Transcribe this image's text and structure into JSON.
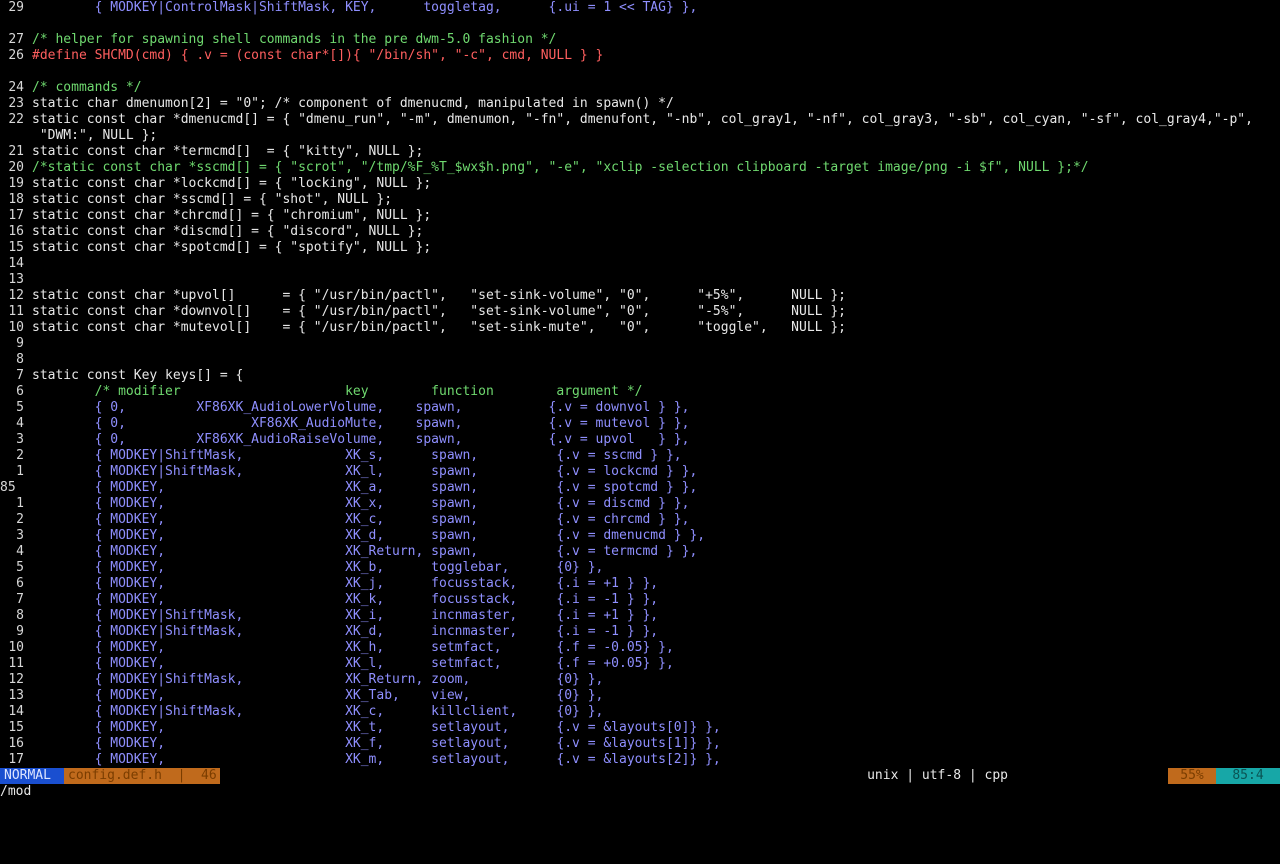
{
  "editor": {
    "lines": [
      {
        "n": "29",
        "t": "        { MODKEY|ControlMask|ShiftMask, KEY,      toggletag,      {.ui = 1 << TAG} },",
        "cls": "v"
      },
      {
        "n": "",
        "t": ""
      },
      {
        "n": "27",
        "t": "/* helper for spawning shell commands in the pre dwm-5.0 fashion */",
        "cls": "c"
      },
      {
        "n": "26",
        "t": "#define SHCMD(cmd) { .v = (const char*[]){ \"/bin/sh\", \"-c\", cmd, NULL } }",
        "cls": "r"
      },
      {
        "n": "",
        "t": ""
      },
      {
        "n": "24",
        "t": "/* commands */",
        "cls": "c"
      },
      {
        "n": "23",
        "t": "static char dmenumon[2] = \"0\"; /* component of dmenucmd, manipulated in spawn() */",
        "cls": "k"
      },
      {
        "n": "22",
        "t": "static const char *dmenucmd[] = { \"dmenu_run\", \"-m\", dmenumon, \"-fn\", dmenufont, \"-nb\", col_gray1, \"-nf\", col_gray3, \"-sb\", col_cyan, \"-sf\", col_gray4,\"-p\",",
        "cls": "k"
      },
      {
        "n": "",
        "t": " \"DWM:\", NULL };",
        "cls": "k"
      },
      {
        "n": "21",
        "t": "static const char *termcmd[]  = { \"kitty\", NULL };",
        "cls": "k"
      },
      {
        "n": "20",
        "t": "/*static const char *sscmd[] = { \"scrot\", \"/tmp/%F_%T_$wx$h.png\", \"-e\", \"xclip -selection clipboard -target image/png -i $f\", NULL };*/",
        "cls": "c"
      },
      {
        "n": "19",
        "t": "static const char *lockcmd[] = { \"locking\", NULL };",
        "cls": "k"
      },
      {
        "n": "18",
        "t": "static const char *sscmd[] = { \"shot\", NULL };",
        "cls": "k"
      },
      {
        "n": "17",
        "t": "static const char *chrcmd[] = { \"chromium\", NULL };",
        "cls": "k"
      },
      {
        "n": "16",
        "t": "static const char *discmd[] = { \"discord\", NULL };",
        "cls": "k"
      },
      {
        "n": "15",
        "t": "static const char *spotcmd[] = { \"spotify\", NULL };",
        "cls": "k"
      },
      {
        "n": "14",
        "t": ""
      },
      {
        "n": "13",
        "t": ""
      },
      {
        "n": "12",
        "t": "static const char *upvol[]      = { \"/usr/bin/pactl\",   \"set-sink-volume\", \"0\",      \"+5%\",      NULL };",
        "cls": "k"
      },
      {
        "n": "11",
        "t": "static const char *downvol[]    = { \"/usr/bin/pactl\",   \"set-sink-volume\", \"0\",      \"-5%\",      NULL };",
        "cls": "k"
      },
      {
        "n": "10",
        "t": "static const char *mutevol[]    = { \"/usr/bin/pactl\",   \"set-sink-mute\",   \"0\",      \"toggle\",   NULL };",
        "cls": "k"
      },
      {
        "n": "9",
        "t": ""
      },
      {
        "n": "8",
        "t": ""
      },
      {
        "n": "7",
        "t": "static const Key keys[] = {",
        "cls": "k"
      },
      {
        "n": "6",
        "t": "        /* modifier                     key        function        argument */",
        "cls": "c",
        "hl": true
      },
      {
        "n": "5",
        "t": "        { 0,         XF86XK_AudioLowerVolume,    spawn,           {.v = downvol } },",
        "cls": "v"
      },
      {
        "n": "4",
        "t": "        { 0,                XF86XK_AudioMute,    spawn,           {.v = mutevol } },",
        "cls": "v"
      },
      {
        "n": "3",
        "t": "        { 0,         XF86XK_AudioRaiseVolume,    spawn,           {.v = upvol   } },",
        "cls": "v"
      },
      {
        "n": "2",
        "t": "        { MODKEY|ShiftMask,             XK_s,      spawn,          {.v = sscmd } },",
        "cls": "v"
      },
      {
        "n": "1",
        "t": "        { MODKEY|ShiftMask,             XK_l,      spawn,          {.v = lockcmd } },",
        "cls": "v"
      },
      {
        "n": "85",
        "t": "        { MODKEY,                       XK_a,      spawn,          {.v = spotcmd } },",
        "cls": "v",
        "cur": true
      },
      {
        "n": "1",
        "t": "        { MODKEY,                       XK_x,      spawn,          {.v = discmd } },",
        "cls": "v"
      },
      {
        "n": "2",
        "t": "        { MODKEY,                       XK_c,      spawn,          {.v = chrcmd } },",
        "cls": "v"
      },
      {
        "n": "3",
        "t": "        { MODKEY,                       XK_d,      spawn,          {.v = dmenucmd } },",
        "cls": "v"
      },
      {
        "n": "4",
        "t": "        { MODKEY,                       XK_Return, spawn,          {.v = termcmd } },",
        "cls": "v"
      },
      {
        "n": "5",
        "t": "        { MODKEY,                       XK_b,      togglebar,      {0} },",
        "cls": "v"
      },
      {
        "n": "6",
        "t": "        { MODKEY,                       XK_j,      focusstack,     {.i = +1 } },",
        "cls": "v"
      },
      {
        "n": "7",
        "t": "        { MODKEY,                       XK_k,      focusstack,     {.i = -1 } },",
        "cls": "v"
      },
      {
        "n": "8",
        "t": "        { MODKEY|ShiftMask,             XK_i,      incnmaster,     {.i = +1 } },",
        "cls": "v"
      },
      {
        "n": "9",
        "t": "        { MODKEY|ShiftMask,             XK_d,      incnmaster,     {.i = -1 } },",
        "cls": "v"
      },
      {
        "n": "10",
        "t": "        { MODKEY,                       XK_h,      setmfact,       {.f = -0.05} },",
        "cls": "v"
      },
      {
        "n": "11",
        "t": "        { MODKEY,                       XK_l,      setmfact,       {.f = +0.05} },",
        "cls": "v"
      },
      {
        "n": "12",
        "t": "        { MODKEY|ShiftMask,             XK_Return, zoom,           {0} },",
        "cls": "v"
      },
      {
        "n": "13",
        "t": "        { MODKEY,                       XK_Tab,    view,           {0} },",
        "cls": "v"
      },
      {
        "n": "14",
        "t": "        { MODKEY|ShiftMask,             XK_c,      killclient,     {0} },",
        "cls": "v"
      },
      {
        "n": "15",
        "t": "        { MODKEY,                       XK_t,      setlayout,      {.v = &layouts[0]} },",
        "cls": "v"
      },
      {
        "n": "16",
        "t": "        { MODKEY,                       XK_f,      setlayout,      {.v = &layouts[1]} },",
        "cls": "v"
      },
      {
        "n": "17",
        "t": "        { MODKEY,                       XK_m,      setlayout,      {.v = &layouts[2]} },",
        "cls": "v"
      }
    ]
  },
  "statusbar": {
    "mode": "NORMAL",
    "file": "config.def.h  |  46",
    "fileinfo": "unix | utf-8 | cpp",
    "percent": "55%",
    "position": "85:4"
  },
  "cmdline": "/mod"
}
